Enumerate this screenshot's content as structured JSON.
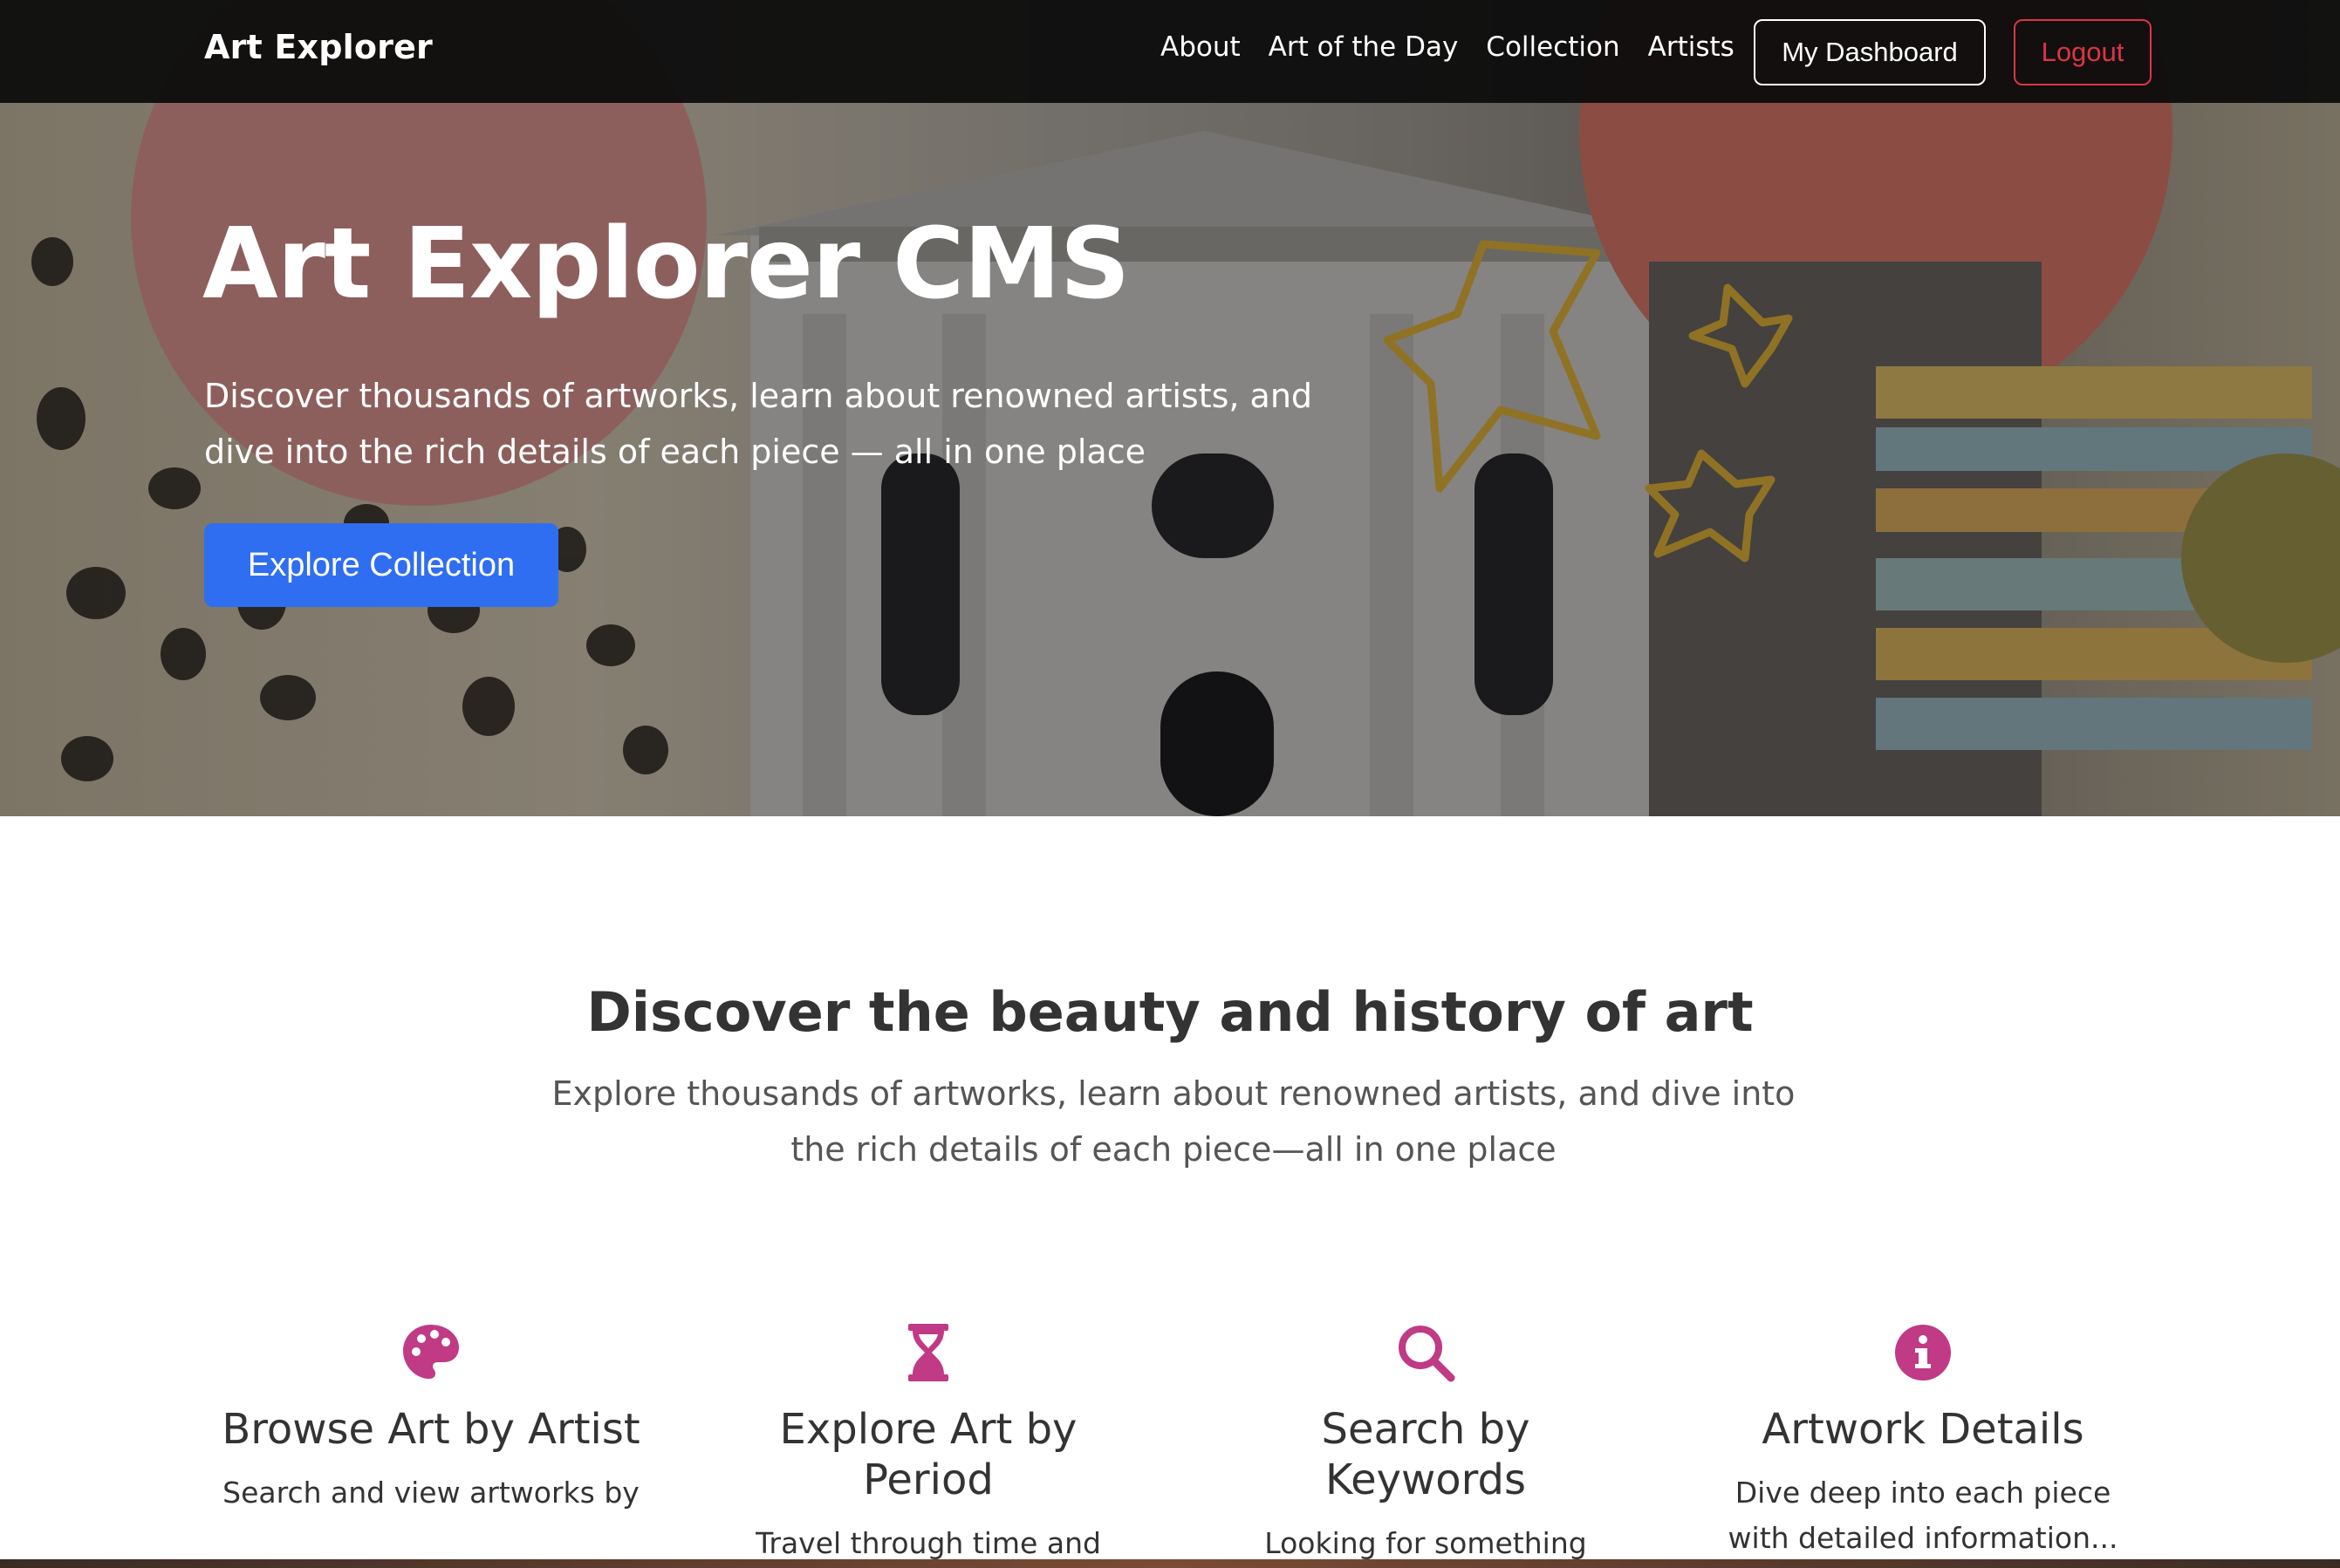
{
  "navbar": {
    "brand": "Art Explorer",
    "links": [
      "About",
      "Art of the Day",
      "Collection",
      "Artists"
    ],
    "dashboard_label": "My Dashboard",
    "logout_label": "Logout"
  },
  "hero": {
    "title": "Art Explorer CMS",
    "subtitle": "Discover thousands of artworks, learn about renowned artists, and dive into the rich details of each piece — all in one place",
    "cta_label": "Explore Collection"
  },
  "intro": {
    "title": "Discover the beauty and history of art",
    "text": "Explore thousands of artworks, learn about renowned artists, and dive into the rich details of each piece—all in one place"
  },
  "features": [
    {
      "icon": "palette-icon",
      "title": "Browse Art by Artist",
      "text": "Search and view artworks by"
    },
    {
      "icon": "hourglass-icon",
      "title": "Explore Art by Period",
      "text": "Travel through time and"
    },
    {
      "icon": "search-icon",
      "title": "Search by Keywords",
      "text": "Looking for something"
    },
    {
      "icon": "info-icon",
      "title": "Artwork Details",
      "text": "Dive deep into each piece with detailed information..."
    }
  ],
  "colors": {
    "accent": "#c03a85",
    "primary_button": "#2f6ef0",
    "logout": "#dc3545",
    "navbar": "#0c0c0c"
  }
}
